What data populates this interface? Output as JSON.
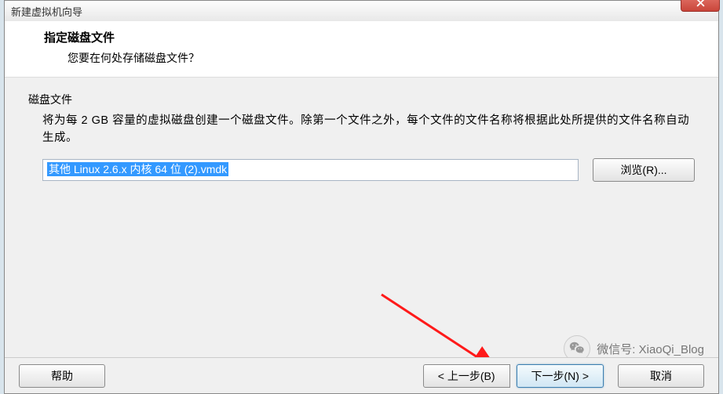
{
  "window": {
    "title": "新建虚拟机向导"
  },
  "header": {
    "title": "指定磁盘文件",
    "subtitle": "您要在何处存储磁盘文件？"
  },
  "section": {
    "label": "磁盘文件",
    "desc": "将为每 2 GB 容量的虚拟磁盘创建一个磁盘文件。除第一个文件之外，每个文件的文件名称将根据此处所提供的文件名称自动生成。"
  },
  "input": {
    "value": "其他 Linux 2.6.x 内核 64 位 (2).vmdk"
  },
  "buttons": {
    "browse": "浏览(R)...",
    "help": "帮助",
    "back": "< 上一步(B)",
    "next": "下一步(N) >",
    "cancel": "取消"
  },
  "watermark": {
    "label": "微信号",
    "value": "XiaoQi_Blog"
  }
}
